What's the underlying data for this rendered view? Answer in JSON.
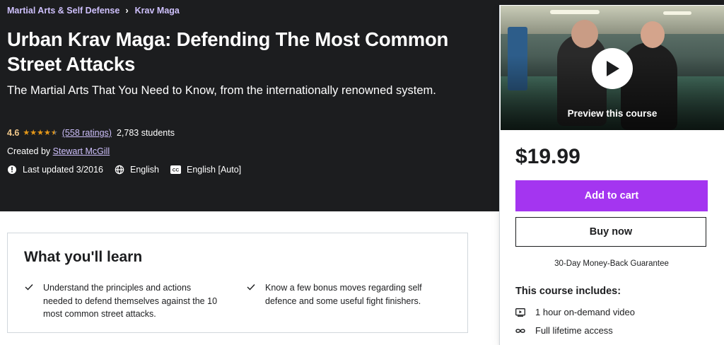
{
  "breadcrumb": {
    "items": [
      "Martial Arts & Self Defense",
      "Krav Maga"
    ],
    "separator_icon": "chevron-right-icon"
  },
  "course": {
    "title": "Urban Krav Maga: Defending The Most Common Street Attacks",
    "subtitle": "The Martial Arts That You Need to Know, from the internationally renowned system.",
    "rating": "4.6",
    "rating_stars_value": 4.5,
    "ratings_count": "(558 ratings)",
    "students": "2,783 students",
    "created_by_label": "Created by",
    "instructor": "Stewart McGill",
    "last_updated": "Last updated 3/2016",
    "language": "English",
    "captions": "English [Auto]"
  },
  "sidebar": {
    "preview_label": "Preview this course",
    "price": "$19.99",
    "add_to_cart": "Add to cart",
    "buy_now": "Buy now",
    "guarantee": "30-Day Money-Back Guarantee",
    "includes_title": "This course includes:",
    "includes": [
      {
        "icon": "video-icon",
        "label": "1 hour on-demand video"
      },
      {
        "icon": "infinity-icon",
        "label": "Full lifetime access"
      }
    ]
  },
  "learn": {
    "heading": "What you'll learn",
    "items": [
      "Understand the principles and actions needed to defend themselves against the 10 most common street attacks.",
      "Know a few bonus moves regarding self defence and some useful fight finishers."
    ]
  },
  "colors": {
    "hero_bg": "#1c1d1f",
    "link_purple": "#cec0fc",
    "star_orange": "#e59819",
    "rating_text": "#f3ca8c",
    "primary_button": "#a435f0"
  }
}
